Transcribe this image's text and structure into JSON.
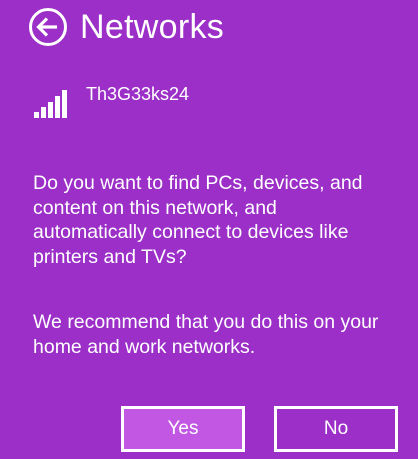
{
  "header": {
    "title": "Networks",
    "back_icon": "back-arrow-icon"
  },
  "network": {
    "name": "Th3G33ks24",
    "signal_icon": "wifi-signal-icon"
  },
  "prompt": {
    "question": "Do you want to find PCs, devices, and content on this network, and automatically connect to devices like printers and TVs?",
    "recommendation": "We recommend that you do this on your home and work networks."
  },
  "buttons": {
    "yes_label": "Yes",
    "no_label": "No"
  },
  "colors": {
    "background": "#9b2fc7",
    "yes_button_fill": "#c257e3",
    "text": "#ffffff"
  }
}
